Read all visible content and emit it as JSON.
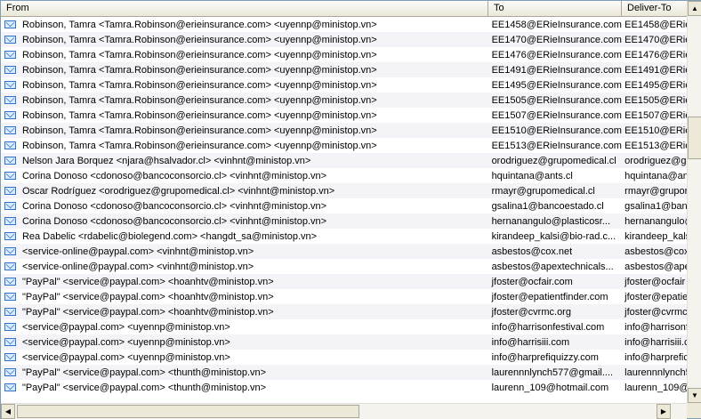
{
  "columns": {
    "from": "From",
    "to": "To",
    "deliver_to": "Deliver-To"
  },
  "rows": [
    {
      "from": "Robinson, Tamra <Tamra.Robinson@erieinsurance.com> <uyennp@ministop.vn>",
      "to": "EE1458@ERieInsurance.com",
      "deliver": "EE1458@ERieI"
    },
    {
      "from": "Robinson, Tamra <Tamra.Robinson@erieinsurance.com> <uyennp@ministop.vn>",
      "to": "EE1470@ERieInsurance.com",
      "deliver": "EE1470@ERieI"
    },
    {
      "from": "Robinson, Tamra <Tamra.Robinson@erieinsurance.com> <uyennp@ministop.vn>",
      "to": "EE1476@ERieInsurance.com",
      "deliver": "EE1476@ERieI"
    },
    {
      "from": "Robinson, Tamra <Tamra.Robinson@erieinsurance.com> <uyennp@ministop.vn>",
      "to": "EE1491@ERieInsurance.com",
      "deliver": "EE1491@ERieI"
    },
    {
      "from": "Robinson, Tamra <Tamra.Robinson@erieinsurance.com> <uyennp@ministop.vn>",
      "to": "EE1495@ERieInsurance.com",
      "deliver": "EE1495@ERieI"
    },
    {
      "from": "Robinson, Tamra <Tamra.Robinson@erieinsurance.com> <uyennp@ministop.vn>",
      "to": "EE1505@ERieInsurance.com",
      "deliver": "EE1505@ERieI"
    },
    {
      "from": "Robinson, Tamra <Tamra.Robinson@erieinsurance.com> <uyennp@ministop.vn>",
      "to": "EE1507@ERieInsurance.com",
      "deliver": "EE1507@ERieI"
    },
    {
      "from": "Robinson, Tamra <Tamra.Robinson@erieinsurance.com> <uyennp@ministop.vn>",
      "to": "EE1510@ERieInsurance.com",
      "deliver": "EE1510@ERieI"
    },
    {
      "from": "Robinson, Tamra <Tamra.Robinson@erieinsurance.com> <uyennp@ministop.vn>",
      "to": "EE1513@ERieInsurance.com",
      "deliver": "EE1513@ERieI"
    },
    {
      "from": "Nelson Jara Borquez <njara@hsalvador.cl> <vinhnt@ministop.vn>",
      "to": "orodriguez@grupomedical.cl",
      "deliver": "orodriguez@gr"
    },
    {
      "from": "Corina Donoso <cdonoso@bancoconsorcio.cl> <vinhnt@ministop.vn>",
      "to": "hquintana@ants.cl",
      "deliver": "hquintana@an"
    },
    {
      "from": "Oscar Rodríguez <orodriguez@grupomedical.cl> <vinhnt@ministop.vn>",
      "to": "rmayr@grupomedical.cl",
      "deliver": "rmayr@grupor"
    },
    {
      "from": "Corina Donoso <cdonoso@bancoconsorcio.cl> <vinhnt@ministop.vn>",
      "to": "gsalina1@bancoestado.cl",
      "deliver": "gsalina1@banc"
    },
    {
      "from": "Corina Donoso <cdonoso@bancoconsorcio.cl> <vinhnt@ministop.vn>",
      "to": "hernanangulo@plasticosr...",
      "deliver": "hernanangulo@"
    },
    {
      "from": "Rea Dabelic <rdabelic@biolegend.com> <hangdt_sa@ministop.vn>",
      "to": "kirandeep_kalsi@bio-rad.c...",
      "deliver": "kirandeep_kals"
    },
    {
      "from": "<service-online@paypal.com> <vinhnt@ministop.vn>",
      "to": "asbestos@cox.net",
      "deliver": "asbestos@cox"
    },
    {
      "from": "<service-online@paypal.com> <vinhnt@ministop.vn>",
      "to": "asbestos@apextechnicals...",
      "deliver": "asbestos@ape"
    },
    {
      "from": "\"PayPal\" <service@paypal.com> <hoanhtv@ministop.vn>",
      "to": "jfoster@ocfair.com",
      "deliver": "jfoster@ocfair"
    },
    {
      "from": "\"PayPal\" <service@paypal.com> <hoanhtv@ministop.vn>",
      "to": "jfoster@epatientfinder.com",
      "deliver": "jfoster@epatie"
    },
    {
      "from": "\"PayPal\" <service@paypal.com> <hoanhtv@ministop.vn>",
      "to": "jfoster@cvrmc.org",
      "deliver": "jfoster@cvrmc"
    },
    {
      "from": "<service@paypal.com> <uyennp@ministop.vn>",
      "to": "info@harrisonfestival.com",
      "deliver": "info@harrisonf"
    },
    {
      "from": "<service@paypal.com> <uyennp@ministop.vn>",
      "to": "info@harrisiii.com",
      "deliver": "info@harrisiii.c"
    },
    {
      "from": "<service@paypal.com> <uyennp@ministop.vn>",
      "to": "info@harprefiquizzy.com",
      "deliver": "info@harprefic"
    },
    {
      "from": "\"PayPal\" <service@paypal.com> <thunth@ministop.vn>",
      "to": "laurennnlynch577@gmail....",
      "deliver": "laurennnlynch5"
    },
    {
      "from": "\"PayPal\" <service@paypal.com> <thunth@ministop.vn>",
      "to": "laurenn_109@hotmail.com",
      "deliver": "laurenn_109@"
    }
  ],
  "scroll": {
    "up": "▲",
    "down": "▼",
    "left": "◀",
    "right": "▶"
  }
}
